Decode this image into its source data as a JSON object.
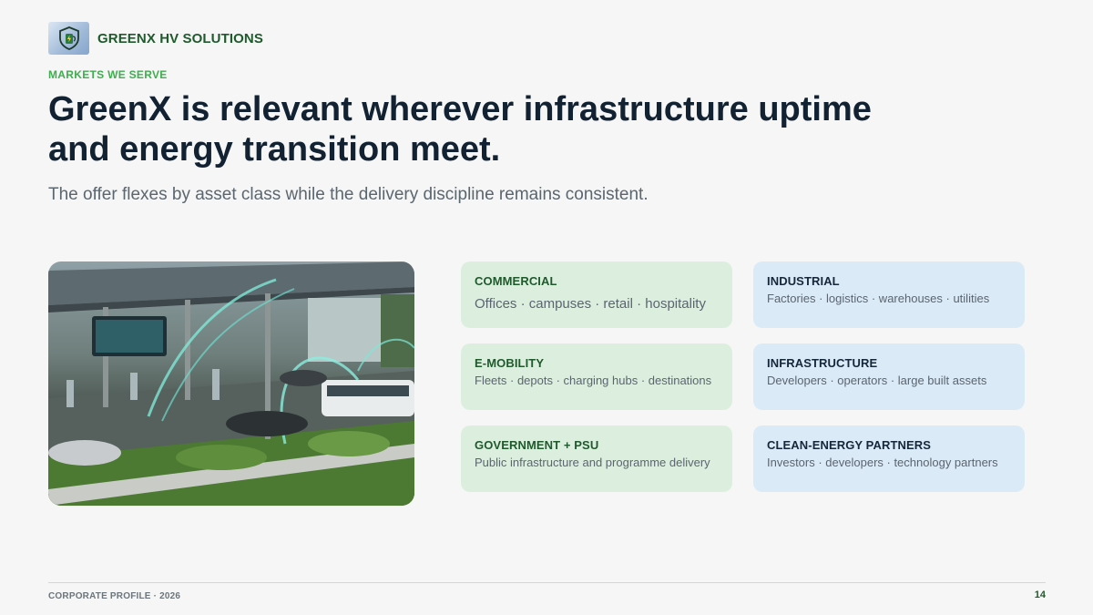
{
  "brand": {
    "name": "GREENX HV SOLUTIONS",
    "logo_icon": "ev-charger-shield-icon"
  },
  "eyebrow": "MARKETS WE SERVE",
  "title": "GreenX is relevant wherever infrastructure uptime and energy transition meet.",
  "subtitle": "The offer flexes by asset class while the delivery discipline remains consistent.",
  "hero_image": {
    "subject": "ev-charging-plaza-illustration"
  },
  "markets": [
    {
      "title": "COMMERCIAL",
      "body": "Offices · campuses · retail · hospitality",
      "tone": "green"
    },
    {
      "title": "INDUSTRIAL",
      "body": "Factories · logistics · warehouses · utilities",
      "tone": "blue"
    },
    {
      "title": "E-MOBILITY",
      "body": "Fleets · depots · charging hubs · destinations",
      "tone": "green"
    },
    {
      "title": "INFRASTRUCTURE",
      "body": "Developers · operators · large built assets",
      "tone": "blue"
    },
    {
      "title": "GOVERNMENT + PSU",
      "body": "Public infrastructure and programme delivery",
      "tone": "green"
    },
    {
      "title": "CLEAN-ENERGY PARTNERS",
      "body": "Investors · developers · technology partners",
      "tone": "blue"
    }
  ],
  "footer": {
    "left": "CORPORATE PROFILE · 2026",
    "page_number": "14"
  },
  "colors": {
    "brand_green": "#1f5a2c",
    "accent_green": "#3fae4f",
    "card_green": "#dcefdf",
    "card_blue": "#dbeaf7",
    "title": "#122232"
  }
}
